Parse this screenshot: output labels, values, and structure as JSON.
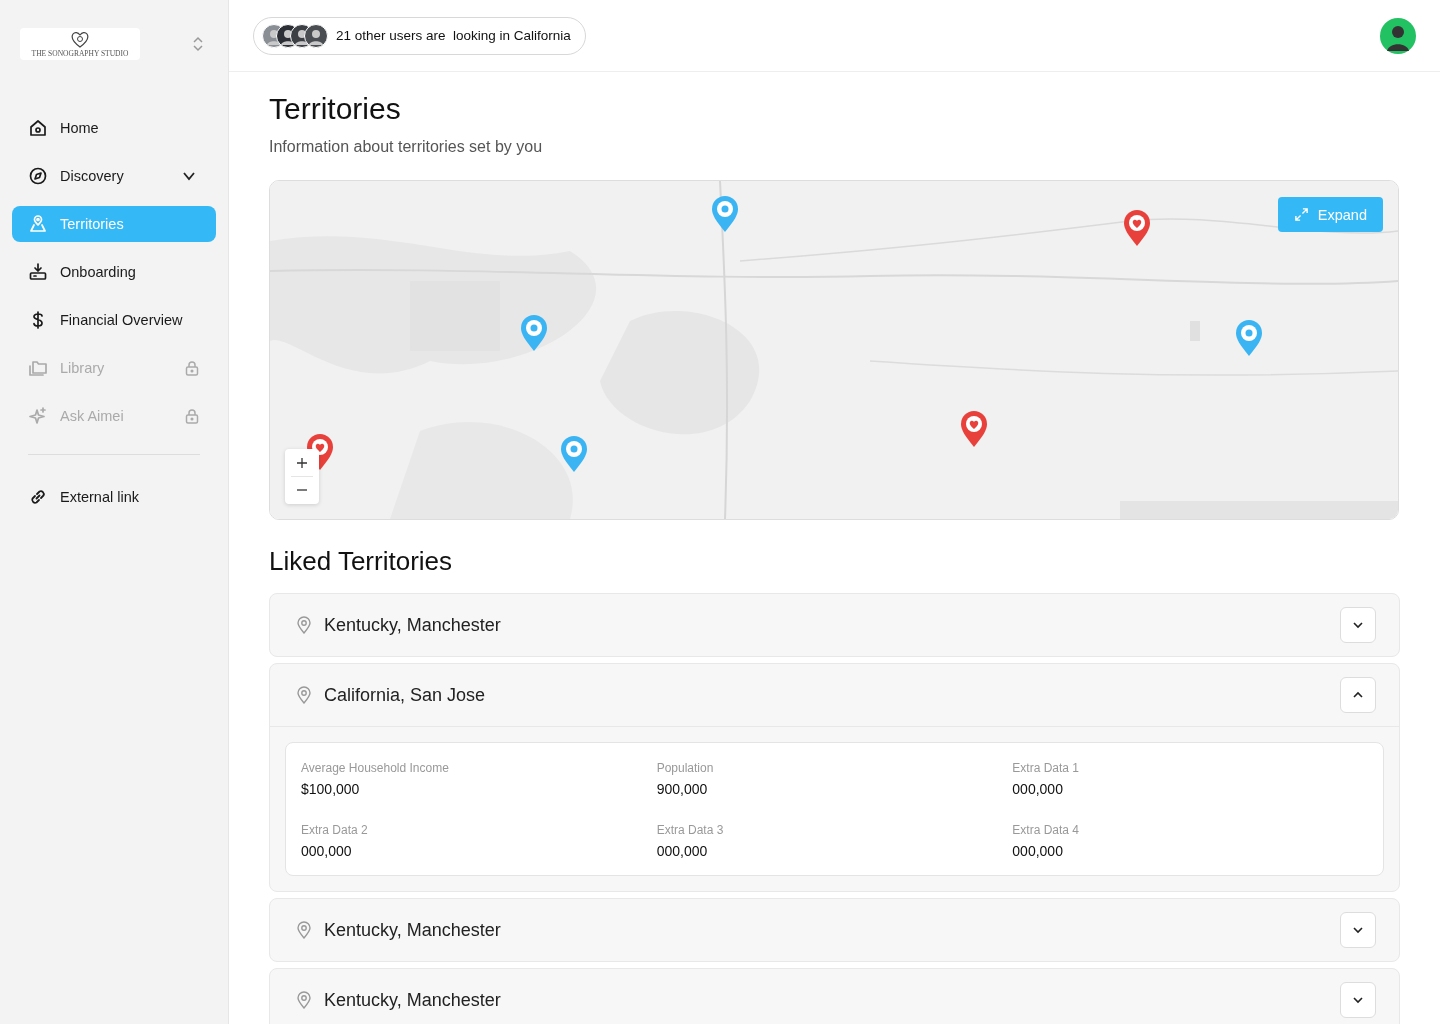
{
  "sidebar": {
    "logo": {
      "text": "THE SONOGRAPHY STUDIO"
    },
    "items": [
      {
        "label": "Home",
        "selected": false,
        "locked": false,
        "kind": "link"
      },
      {
        "label": "Discovery",
        "selected": false,
        "locked": false,
        "kind": "menu",
        "expanded": false
      },
      {
        "label": "Territories",
        "selected": true,
        "locked": false,
        "kind": "link"
      },
      {
        "label": "Onboarding",
        "selected": false,
        "locked": false,
        "kind": "link"
      },
      {
        "label": "Financial Overview",
        "selected": false,
        "locked": false,
        "kind": "link"
      },
      {
        "label": "Library",
        "selected": false,
        "locked": true,
        "kind": "link"
      },
      {
        "label": "Ask Aimei",
        "selected": false,
        "locked": true,
        "kind": "link"
      }
    ],
    "footer_items": [
      {
        "label": "External link"
      }
    ]
  },
  "top_bar": {
    "presence": {
      "text": "21 other users are  looking in California"
    }
  },
  "page": {
    "title": "Territories",
    "subtitle": "Information about territories set by you"
  },
  "map": {
    "expand_button": "Expand",
    "pins": [
      {
        "kind": "liked"
      },
      {
        "kind": "viewed"
      },
      {
        "kind": "liked"
      },
      {
        "kind": "viewed"
      },
      {
        "kind": "viewed"
      },
      {
        "kind": "liked"
      },
      {
        "kind": "viewed"
      }
    ]
  },
  "liked_territories": {
    "title": "Liked Territories",
    "items": [
      {
        "name": "Kentucky, Manchester",
        "expanded": false
      },
      {
        "name": "California, San Jose",
        "expanded": true,
        "details": [
          {
            "label": "Average Household Income",
            "value": "$100,000"
          },
          {
            "label": "Population",
            "value": "900,000"
          },
          {
            "label": "Extra Data 1",
            "value": "000,000"
          },
          {
            "label": "Extra Data 2",
            "value": "000,000"
          },
          {
            "label": "Extra Data 3",
            "value": "000,000"
          },
          {
            "label": "Extra Data 4",
            "value": "000,000"
          }
        ]
      },
      {
        "name": "Kentucky, Manchester",
        "expanded": false
      },
      {
        "name": "Kentucky, Manchester",
        "expanded": false
      }
    ]
  }
}
